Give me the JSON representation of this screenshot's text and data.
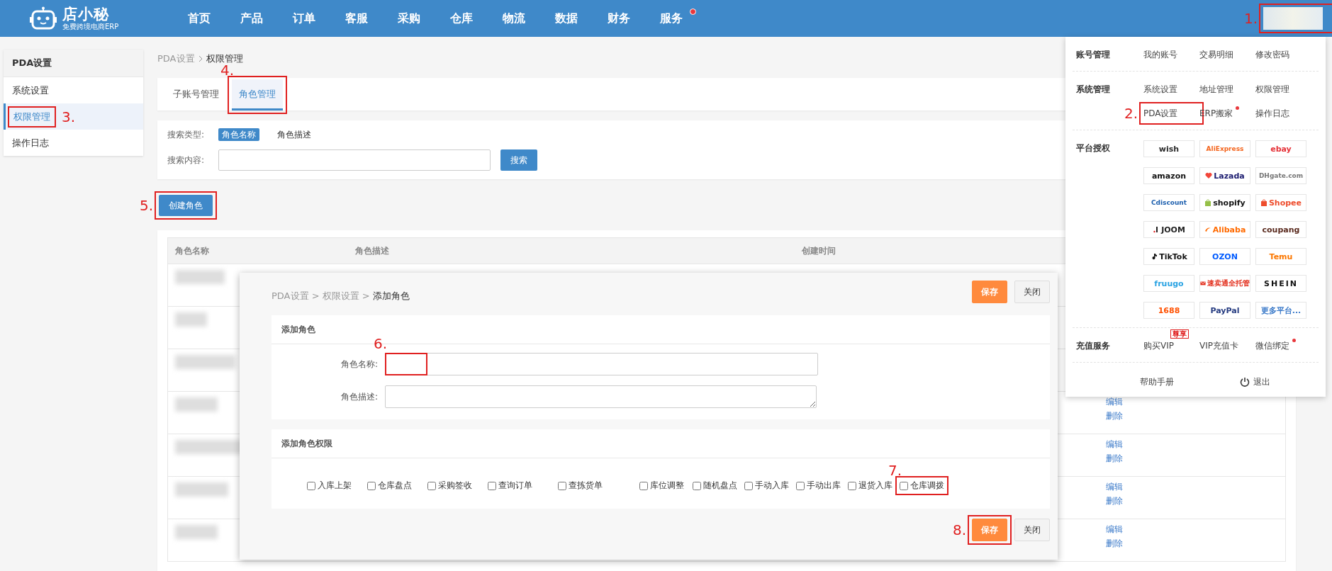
{
  "header": {
    "logo": {
      "name": "店小秘",
      "tagline": "免费跨境电商ERP"
    },
    "nav": [
      {
        "label": "首页",
        "dot": false
      },
      {
        "label": "产品",
        "dot": false
      },
      {
        "label": "订单",
        "dot": false
      },
      {
        "label": "客服",
        "dot": false
      },
      {
        "label": "采购",
        "dot": false
      },
      {
        "label": "仓库",
        "dot": false
      },
      {
        "label": "物流",
        "dot": false
      },
      {
        "label": "数据",
        "dot": false
      },
      {
        "label": "财务",
        "dot": false
      },
      {
        "label": "服务",
        "dot": true
      }
    ],
    "account": {
      "note": "1."
    }
  },
  "sidebar": {
    "title": "PDA设置",
    "items": [
      {
        "label": "系统设置",
        "selected": false
      },
      {
        "label": "权限管理",
        "selected": true,
        "note": "3."
      },
      {
        "label": "操作日志",
        "selected": false
      }
    ]
  },
  "breadcrumb": {
    "items": [
      "PDA设置",
      "权限管理"
    ]
  },
  "tabs": [
    {
      "label": "子账号管理",
      "selected": false
    },
    {
      "label": "角色管理",
      "selected": true,
      "note": "4."
    }
  ],
  "search": {
    "type_label": "搜索类型:",
    "types": [
      {
        "label": "角色名称",
        "selected": true
      },
      {
        "label": "角色描述",
        "selected": false
      }
    ],
    "content_label": "搜索内容:",
    "button": "搜索"
  },
  "create_button": {
    "label": "创建角色",
    "note": "5."
  },
  "table": {
    "columns": [
      "角色名称",
      "角色描述",
      "创建时间"
    ],
    "rows": [
      {
        "redacted": true
      },
      {
        "redacted": true
      },
      {
        "redacted": true
      },
      {
        "redacted": true,
        "actions": [
          "编辑",
          "删除"
        ]
      },
      {
        "redacted": true,
        "actions": [
          "编辑",
          "删除"
        ]
      },
      {
        "redacted": true,
        "actions": [
          "编辑",
          "删除"
        ]
      },
      {
        "redacted": true,
        "actions": [
          "编辑",
          "删除"
        ]
      }
    ]
  },
  "modal": {
    "breadcrumb": {
      "items": [
        "PDA设置",
        "权限设置",
        "添加角色"
      ],
      "separator": ">"
    },
    "top_buttons": [
      {
        "label": "保存",
        "kind": "primary"
      },
      {
        "label": "关闭",
        "kind": "default"
      }
    ],
    "role_section": {
      "title": "添加角色",
      "fields": [
        {
          "label": "角色名称:",
          "kind": "input",
          "note": "6."
        },
        {
          "label": "角色描述:",
          "kind": "textarea"
        }
      ]
    },
    "perm_section": {
      "title": "添加角色权限",
      "permissions": [
        {
          "label": "入库上架",
          "checked": false
        },
        {
          "label": "仓库盘点",
          "checked": false
        },
        {
          "label": "采购签收",
          "checked": false
        },
        {
          "label": "查询订单",
          "checked": false
        },
        {
          "label": "查拣货单",
          "checked": false
        },
        {
          "label": "库位调整",
          "checked": false
        },
        {
          "label": "随机盘点",
          "checked": false
        },
        {
          "label": "手动入库",
          "checked": false
        },
        {
          "label": "手动出库",
          "checked": false
        },
        {
          "label": "退货入库",
          "checked": false
        },
        {
          "label": "仓库调拨",
          "checked": false,
          "note": "7."
        }
      ]
    },
    "bottom_buttons": [
      {
        "label": "保存",
        "kind": "primary",
        "note": "8."
      },
      {
        "label": "关闭",
        "kind": "default"
      }
    ]
  },
  "dropdown": {
    "groups": [
      {
        "title": "账号管理",
        "items": [
          {
            "label": "我的账号",
            "dot": false
          },
          {
            "label": "交易明细",
            "dot": false
          },
          {
            "label": "修改密码",
            "dot": false
          }
        ]
      },
      {
        "title": "系统管理",
        "items": [
          {
            "label": "系统设置",
            "dot": false
          },
          {
            "label": "地址管理",
            "dot": false
          },
          {
            "label": "权限管理",
            "dot": false
          },
          {
            "label": "PDA设置",
            "dot": false,
            "note": "2."
          },
          {
            "label": "ERP搬家",
            "dot": true
          },
          {
            "label": "操作日志",
            "dot": false
          }
        ]
      },
      {
        "title": "平台授权",
        "platforms": [
          {
            "label": "wish",
            "color": "#2b2b2b"
          },
          {
            "label": "AliExpress",
            "color": "#f4661f"
          },
          {
            "label": "ebay",
            "color": "#e53238"
          },
          {
            "label": "amazon",
            "color": "#111111"
          },
          {
            "label": "Lazada",
            "color": "#1b1b6f"
          },
          {
            "label": "DHgate.com",
            "color": "#777777"
          },
          {
            "label": "Cdiscount",
            "color": "#1c5fae"
          },
          {
            "label": "shopify",
            "color": "#111111"
          },
          {
            "label": "Shopee",
            "color": "#ee4d2d"
          },
          {
            "label": "JOOM",
            "color": "#222222"
          },
          {
            "label": "Alibaba",
            "color": "#ff6a00"
          },
          {
            "label": "coupang",
            "color": "#5a2a1e"
          },
          {
            "label": "TikTok",
            "color": "#111111"
          },
          {
            "label": "OZON",
            "color": "#005bff"
          },
          {
            "label": "Temu",
            "color": "#fb7701"
          },
          {
            "label": "fruugo",
            "color": "#2aa3e3"
          },
          {
            "label": "速卖通全托管",
            "color": "#e3301e"
          },
          {
            "label": "SHEIN",
            "color": "#111111"
          },
          {
            "label": "1688",
            "color": "#ff5000"
          },
          {
            "label": "PayPal",
            "color": "#253b80"
          },
          {
            "label": "更多平台...",
            "color": "#3b7ac9"
          }
        ]
      },
      {
        "title": "充值服务",
        "items": [
          {
            "label": "购买VIP",
            "dot": false,
            "badge": "尊享"
          },
          {
            "label": "VIP充值卡",
            "dot": false
          },
          {
            "label": "微信绑定",
            "dot": true
          }
        ]
      }
    ],
    "footer": {
      "help": "帮助手册",
      "logout": "退出"
    }
  }
}
